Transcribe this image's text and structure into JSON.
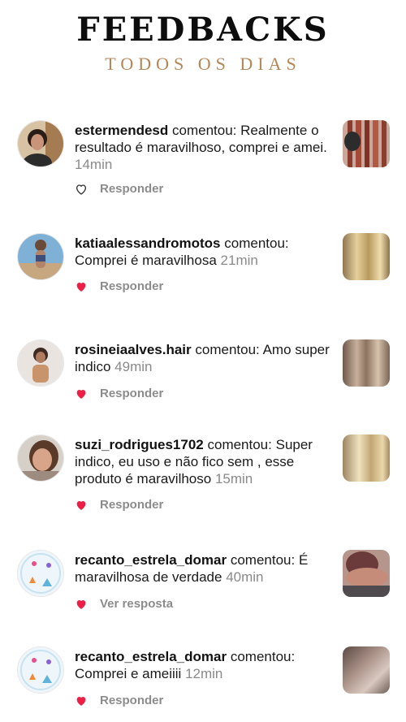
{
  "header": {
    "title": "FEEDBACKS",
    "subtitle": "TODOS OS DIAS"
  },
  "comments": [
    {
      "username": "estermendesd",
      "verb": "comentou:",
      "text": "Realmente o resultado é  maravilhoso,  comprei e amei.",
      "time": "14min",
      "action": "Responder",
      "liked": false
    },
    {
      "username": "katiaalessandromotos",
      "verb": "comentou:",
      "text": "Comprei é maravilhosa",
      "time": "21min",
      "action": "Responder",
      "liked": true
    },
    {
      "username": "rosineiaalves.hair",
      "verb": "comentou:",
      "text": "Amo super indico",
      "time": "49min",
      "action": "Responder",
      "liked": true
    },
    {
      "username": "suzi_rodrigues1702",
      "verb": "comentou:",
      "text": "Super indico,  eu uso e não fico sem , esse produto é maravilhoso",
      "time": "15min",
      "action": "Responder",
      "liked": true
    },
    {
      "username": "recanto_estrela_domar",
      "verb": "comentou:",
      "text": "É maravilhosa de verdade",
      "time": "40min",
      "action": "Ver resposta",
      "liked": true
    },
    {
      "username": "recanto_estrela_domar",
      "verb": "comentou:",
      "text": "Comprei e ameiiii",
      "time": "12min",
      "action": "Responder",
      "liked": true
    }
  ],
  "colors": {
    "heart_liked": "#ed1f45",
    "subtitle": "#b3875a",
    "meta_gray": "#8a8a8a"
  },
  "icons": {
    "like": "heart-icon"
  }
}
